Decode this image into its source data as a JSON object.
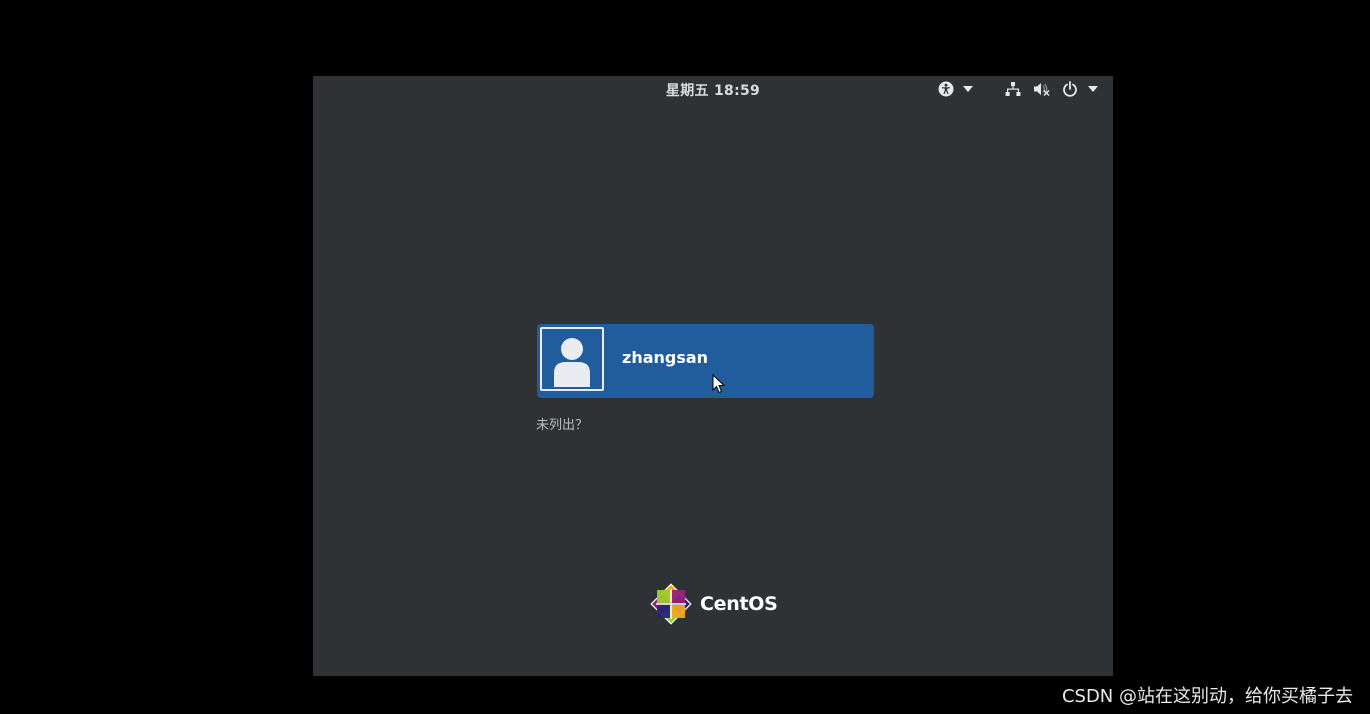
{
  "top_bar": {
    "clock": "星期五 18:59",
    "icons": [
      "accessibility-icon",
      "chevron-down-icon",
      "network-icon",
      "volume-muted-icon",
      "power-icon",
      "chevron-down-icon"
    ]
  },
  "login": {
    "users": [
      {
        "username": "zhangsan",
        "avatar_icon": "user-avatar-icon"
      }
    ],
    "not_listed_label": "未列出？"
  },
  "branding": {
    "logo_text": "CentOS"
  },
  "watermark": "CSDN @站在这别动，给你买橘子去",
  "colors": {
    "background": "#2f3235",
    "selected_user": "#215d9c",
    "outer": "#000000"
  }
}
